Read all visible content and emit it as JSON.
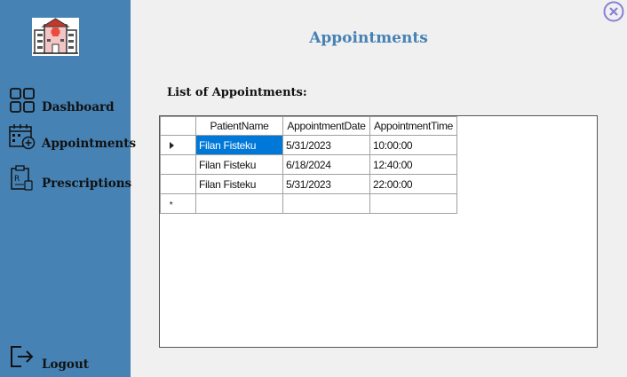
{
  "sidebar": {
    "items": [
      {
        "label": "Dashboard",
        "icon": "dashboard-grid-icon"
      },
      {
        "label": "Appointments",
        "icon": "calendar-add-icon"
      },
      {
        "label": "Prescriptions",
        "icon": "prescription-icon"
      }
    ],
    "logout": {
      "label": "Logout",
      "icon": "logout-icon"
    }
  },
  "header": {
    "title": "Appointments"
  },
  "main": {
    "list_title": "List of Appointments:",
    "table": {
      "columns": [
        "PatientName",
        "AppointmentDate",
        "AppointmentTime"
      ],
      "rows": [
        [
          "Filan Fisteku",
          "5/31/2023",
          "10:00:00"
        ],
        [
          "Filan Fisteku",
          "6/18/2024",
          "12:40:00"
        ],
        [
          "Filan Fisteku",
          "5/31/2023",
          "22:00:00"
        ]
      ],
      "new_row_marker": "*"
    }
  },
  "colors": {
    "sidebar": "#4682b4",
    "title": "#4682b4",
    "selection": "#0078d7",
    "close": "#8a7fd4"
  }
}
